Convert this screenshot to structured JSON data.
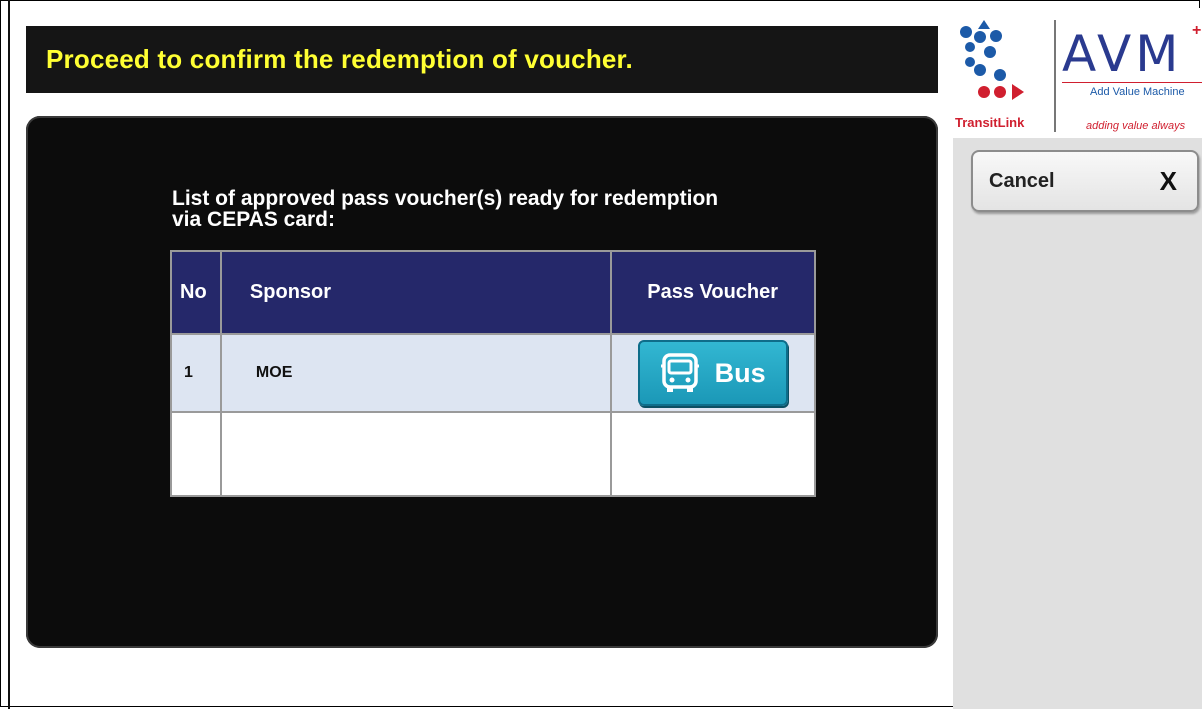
{
  "header": {
    "title": "Proceed to confirm the redemption of voucher."
  },
  "panel": {
    "heading_line1": "List of approved pass voucher(s) ready for redemption",
    "heading_line2": "via CEPAS card:"
  },
  "table": {
    "columns": [
      "No",
      "Sponsor",
      "Pass Voucher"
    ],
    "rows": [
      {
        "no": "1",
        "sponsor": "MOE",
        "voucher_label": "Bus",
        "voucher_icon": "bus-icon"
      },
      {
        "no": "",
        "sponsor": "",
        "voucher_label": "",
        "voucher_icon": ""
      }
    ]
  },
  "brand": {
    "transitlink": "TransitLink",
    "avm": "AVM",
    "avm_plus": "+",
    "avm_subtitle": "Add Value Machine",
    "avm_tagline": "adding value always"
  },
  "actions": {
    "cancel_label": "Cancel",
    "cancel_icon_text": "X"
  },
  "colors": {
    "title_yellow": "#ffff33",
    "table_header": "#25286a",
    "row_highlight": "#dde5f2",
    "bus_button": "#1ea6c4",
    "brand_red": "#d01f2f",
    "brand_blue": "#1c5aa8"
  }
}
